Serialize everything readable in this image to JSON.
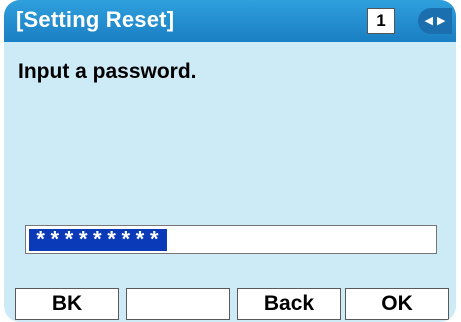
{
  "header": {
    "title": "[Setting Reset]",
    "page_number": "1",
    "nav_icon": "left-right-arrows-icon"
  },
  "main": {
    "prompt": "Input a password.",
    "password_field": {
      "value": "*********"
    }
  },
  "softkeys": {
    "key1": "BK",
    "key2": "",
    "key3": "Back",
    "key4": "OK"
  },
  "colors": {
    "titlebar": "#1a7fc4",
    "background": "#cdeaf7",
    "selection": "#0a3ab8"
  }
}
